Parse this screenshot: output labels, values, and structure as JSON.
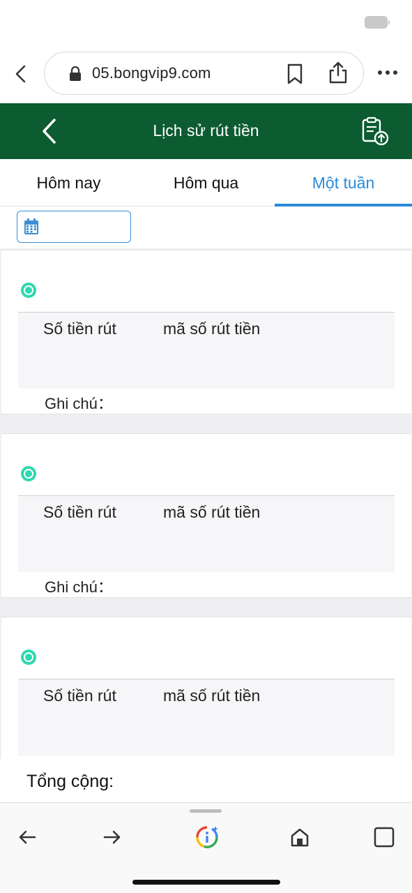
{
  "browser": {
    "url": "05.bongvip9.com"
  },
  "header": {
    "title": "Lịch sử rút tiền"
  },
  "tabs": [
    {
      "label": "Hôm nay",
      "active": false
    },
    {
      "label": "Hôm qua",
      "active": false
    },
    {
      "label": "Một tuần",
      "active": true
    }
  ],
  "date_filter": {
    "value": ""
  },
  "records": [
    {
      "amount_label": "Số tiền rút",
      "code_label": "mã số rút tiền",
      "note_label": "Ghi chú："
    },
    {
      "amount_label": "Số tiền rút",
      "code_label": "mã số rút tiền",
      "note_label": "Ghi chú："
    },
    {
      "amount_label": "Số tiền rút",
      "code_label": "mã số rút tiền"
    }
  ],
  "footer": {
    "total_label": "Tổng cộng:"
  },
  "colors": {
    "header_bg": "#0c5b31",
    "active_tab": "#2b8ad8",
    "status_icon": "#2ed8b0"
  }
}
